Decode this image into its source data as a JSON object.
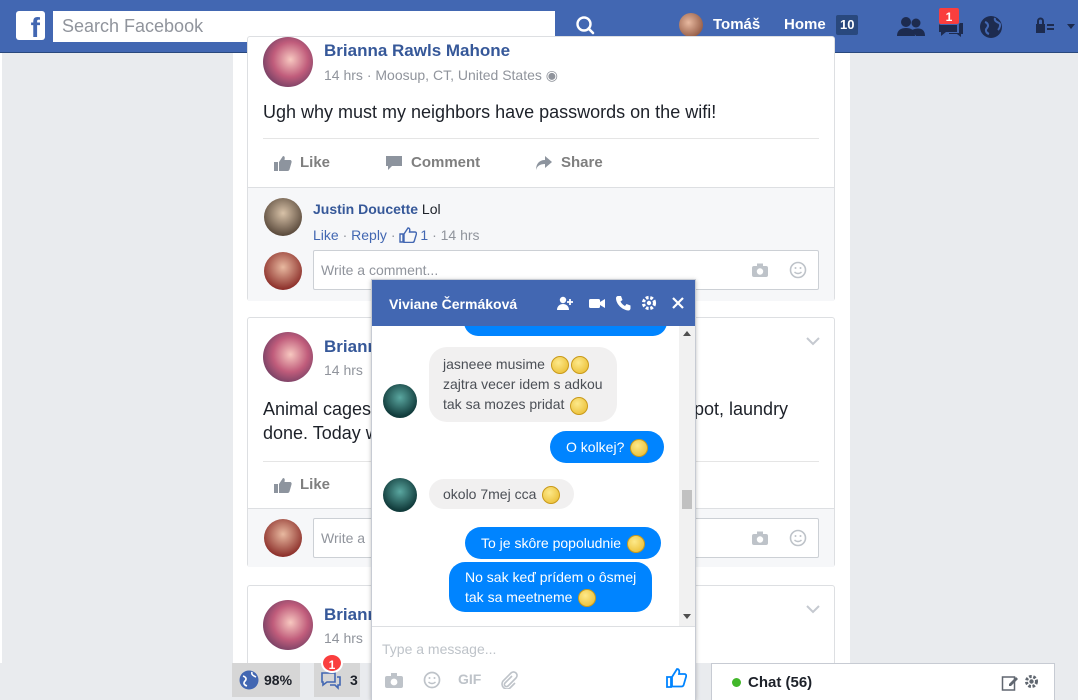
{
  "topbar": {
    "logo": "f",
    "search_placeholder": "Search Facebook",
    "user_name": "Tomáš",
    "home_label": "Home",
    "home_count": "10",
    "notification_count": "1"
  },
  "posts": [
    {
      "author": "Brianna Rawls Mahone",
      "time": "14 hrs",
      "location": "Moosup, CT, United States",
      "text": "Ugh why must my neighbors have passwords on the wifi!",
      "actions": {
        "like": "Like",
        "comment": "Comment",
        "share": "Share"
      },
      "comment": {
        "author": "Justin Doucette",
        "text": "Lol",
        "like": "Like",
        "reply": "Reply",
        "likes": "1",
        "time": "14 hrs"
      },
      "comment_placeholder": "Write a comment..."
    },
    {
      "author": "Brianna",
      "time": "14 hrs",
      "text_line1_start": "Animal cages",
      "text_line1_end": "k pot, laundry",
      "text_line2": "done. Today w",
      "actions": {
        "like": "Like"
      },
      "comment_placeholder": "Write a"
    },
    {
      "author": "Brianna",
      "time": "14 hrs"
    }
  ],
  "chat": {
    "contact": "Viviane Čermáková",
    "messages": [
      {
        "dir": "in",
        "lines": [
          "jasneee musime",
          "zajtra  vecer idem s adkou",
          "tak sa mozes pridat"
        ]
      },
      {
        "dir": "out",
        "lines": [
          "O kolkej?"
        ]
      },
      {
        "dir": "in",
        "lines": [
          "okolo 7mej cca"
        ]
      },
      {
        "dir": "out",
        "lines": [
          "To je skôre popoludnie"
        ]
      },
      {
        "dir": "out",
        "lines": [
          "No sak keď prídem o ôsmej",
          "tak sa meetneme"
        ]
      }
    ],
    "input_placeholder": "Type a message...",
    "gif_label": "GIF"
  },
  "bottom_bar": {
    "zoom": "98%",
    "notifications_count": "3",
    "notifications_badge": "1",
    "chat_label": "Chat (56)"
  },
  "colors": {
    "brand": "#4267b2",
    "message_blue": "#0084ff",
    "link": "#365899",
    "badge_red": "#fa3e3e"
  }
}
